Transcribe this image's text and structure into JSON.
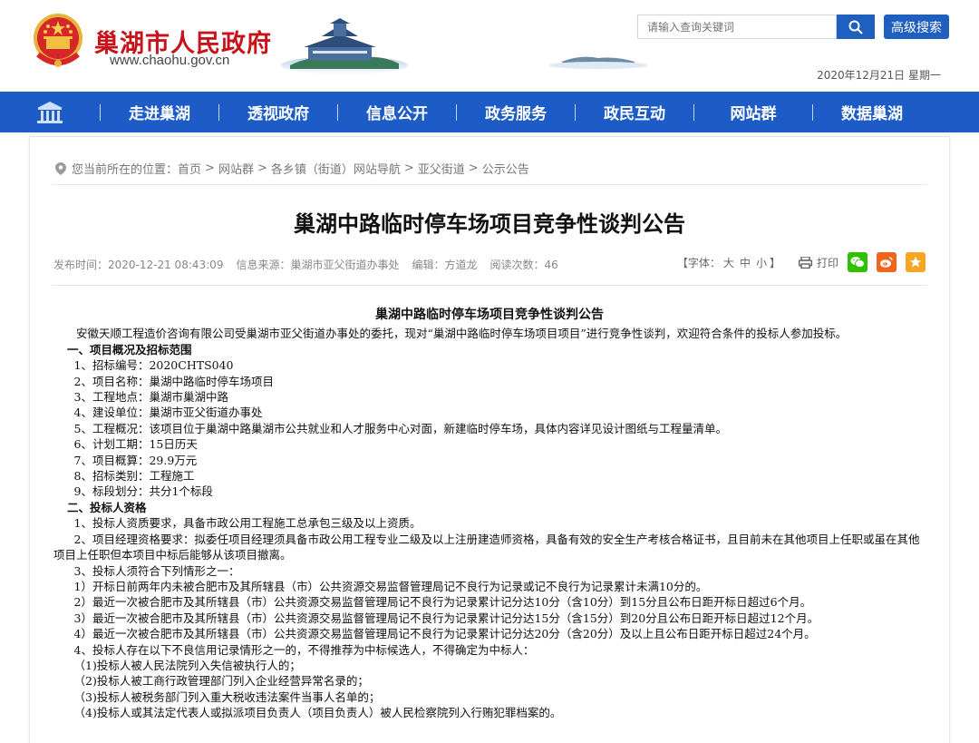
{
  "header": {
    "site_name": "巢湖市人民政府",
    "site_url": "www.chaohu.gov.cn",
    "search_placeholder": "请输入查询关键词",
    "advanced_search": "高级搜索",
    "date": "2020年12月21日 星期一"
  },
  "nav": {
    "items": [
      "走进巢湖",
      "透视政府",
      "信息公开",
      "政务服务",
      "政民互动",
      "网站群",
      "数据巢湖"
    ]
  },
  "breadcrumb": {
    "prefix": "您当前所在的位置：",
    "items": [
      "首页",
      "网站群",
      "各乡镇（街道）网站导航",
      "亚父街道",
      "公示公告"
    ]
  },
  "article": {
    "title": "巢湖中路临时停车场项目竞争性谈判公告",
    "publish_time": "发布时间：2020-12-21 08:43:09",
    "source": "信息来源：巢湖市亚父街道办事处",
    "editor": "编辑：方道龙",
    "views": "阅读次数：46",
    "font_label_open": "【字体：",
    "font_large": "大",
    "font_medium": "中",
    "font_small": "小",
    "font_label_close": "】",
    "print": "打印",
    "content_title": "巢湖中路临时停车场项目竞争性谈判公告",
    "intro": "安徽天顺工程造价咨询有限公司受巢湖市亚父街道办事处的委托，现对“巢湖中路临时停车场项目项目”进行竞争性谈判，欢迎符合条件的投标人参加投标。",
    "section1_title": "一、项目概况及招标范围",
    "section1_items": [
      "1、招标编号：2020CHTS040",
      "2、项目名称：巢湖中路临时停车场项目",
      "3、工程地点：巢湖市巢湖中路",
      "4、建设单位：巢湖市亚父街道办事处",
      "5、工程概况：该项目位于巢湖中路巢湖市公共就业和人才服务中心对面，新建临时停车场，具体内容详见设计图纸与工程量清单。",
      "6、计划工期：15日历天",
      "7、项目概算：29.9万元",
      "8、招标类别：工程施工",
      "9、标段划分：共分1个标段"
    ],
    "section2_title": "二、投标人资格",
    "section2_items": [
      "1、投标人资质要求，具备市政公用工程施工总承包三级及以上资质。",
      "2、项目经理资格要求：拟委任项目经理须具备市政公用工程专业二级及以上注册建造师资格，具备有效的安全生产考核合格证书，且目前未在其他项目上任职或虽在其他项目上任职但本项目中标后能够从该项目撤离。",
      "3、投标人须符合下列情形之一："
    ],
    "section2_sub3": [
      "1）开标日前两年内未被合肥市及其所辖县（市）公共资源交易监督管理局记不良行为记录或记不良行为记录累计未满10分的。",
      "2）最近一次被合肥市及其所辖县（市）公共资源交易监督管理局记不良行为记录累计记分达10分（含10分）到15分且公布日距开标日超过6个月。",
      "3）最近一次被合肥市及其所辖县（市）公共资源交易监督管理局记不良行为记录累计记分达15分（含15分）到20分且公布日距开标日超过12个月。",
      "4）最近一次被合肥市及其所辖县（市）公共资源交易监督管理局记不良行为记录累计记分达20分（含20分）及以上且公布日距开标日超过24个月。"
    ],
    "section2_item4": "4、投标人存在以下不良信用记录情形之一的，不得推荐为中标候选人，不得确定为中标人：",
    "section2_sub4": [
      "（1)投标人被人民法院列入失信被执行人的；",
      "（2)投标人被工商行政管理部门列入企业经营异常名录的；",
      "（3)投标人被税务部门列入重大税收违法案件当事人名单的；",
      "（4)投标人或其法定代表人或拟派项目负责人（项目负责人）被人民检察院列入行贿犯罪档案的。"
    ]
  },
  "colors": {
    "brand_red": "#c7141b",
    "nav_blue": "#1d5cc7",
    "button_blue": "#1f5fbf",
    "wechat_green": "#2dc100",
    "weibo_orange": "#f0641e",
    "favorite_orange": "#f5a623"
  },
  "icons": [
    "national-emblem-icon",
    "search-icon",
    "home-icon",
    "location-pin-icon",
    "printer-icon",
    "wechat-icon",
    "weibo-icon",
    "star-icon"
  ]
}
